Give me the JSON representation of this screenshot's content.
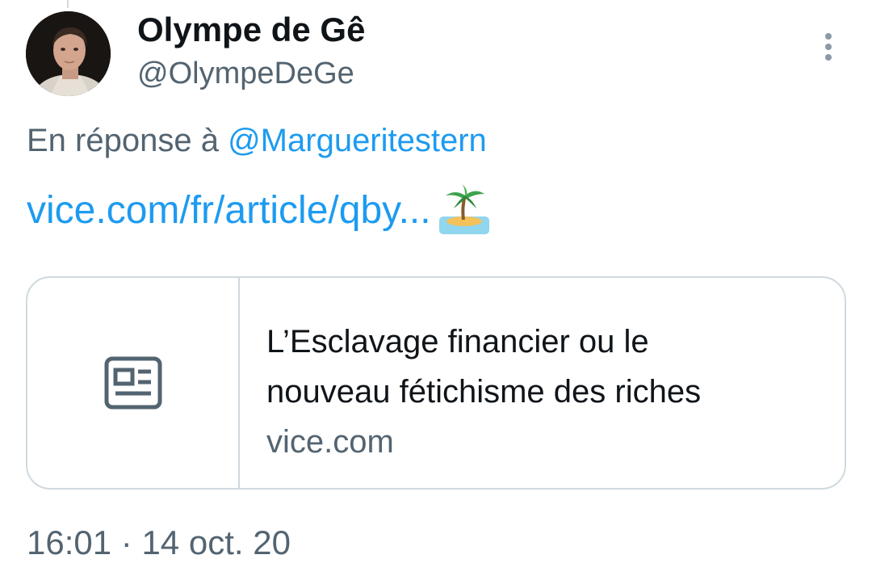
{
  "author": {
    "display_name": "Olympe de Gê",
    "handle": "@OlympeDeGe"
  },
  "reply": {
    "prefix": "En réponse à",
    "mention": "@Margueritestern"
  },
  "tweet": {
    "link_text": "vice.com/fr/article/qby...",
    "emoji_icon": "desert-island-icon"
  },
  "card": {
    "icon": "article-icon",
    "title_line1": "L’Esclavage financier ou le",
    "title_line2": "nouveau fétichisme des riches",
    "domain": "vice.com"
  },
  "meta": {
    "time": "16:01",
    "separator": "·",
    "date": "14 oct. 20"
  },
  "colors": {
    "accent": "#1d9bf0",
    "secondary_text": "#536471",
    "border": "#cfd9de"
  }
}
